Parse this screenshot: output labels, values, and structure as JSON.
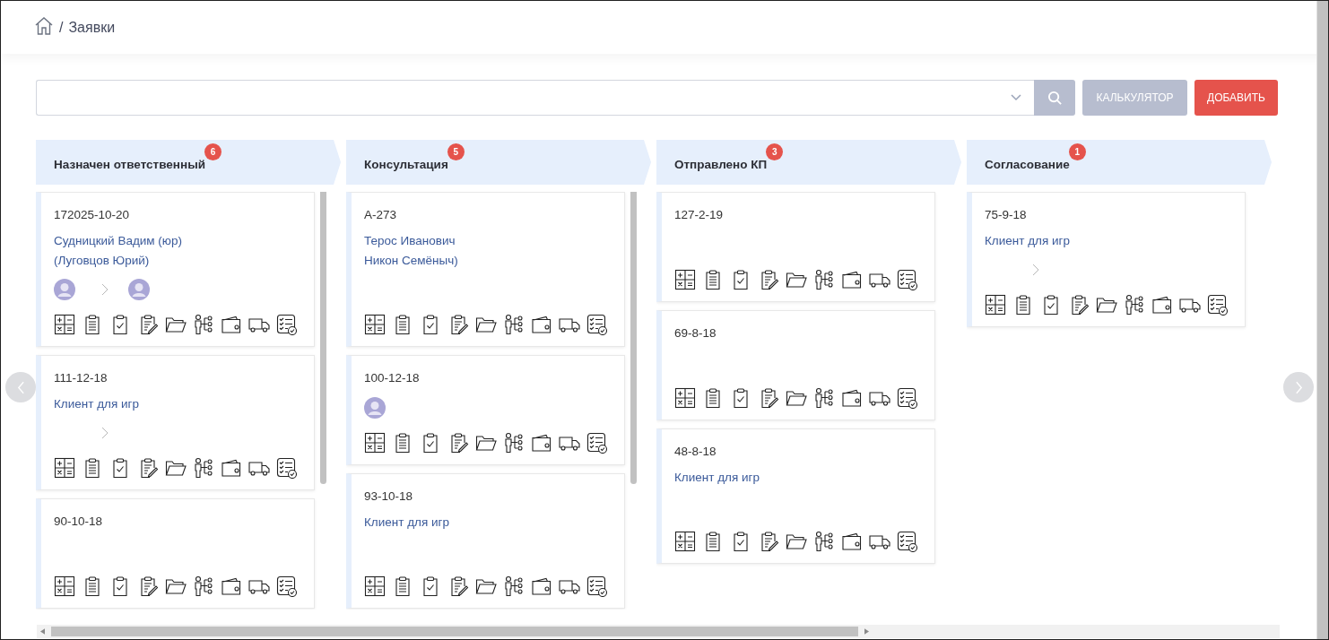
{
  "breadcrumb": {
    "separator": "/",
    "current": "Заявки"
  },
  "toolbar": {
    "calculator_button": "КАЛЬКУЛЯТОР",
    "add_button": "ДОБАВИТЬ"
  },
  "columns": [
    {
      "title": "Назначен ответственный",
      "count": "6",
      "scrollable": true,
      "cards": [
        {
          "number": "172025-10-20",
          "client_lines": [
            "Судницкий Вадим (юр)",
            "(Луговцов Юрий)"
          ],
          "people": [
            {
              "kind": "avatar"
            },
            {
              "kind": "arrow"
            },
            {
              "kind": "avatar"
            }
          ]
        },
        {
          "number": "111-12-18",
          "client_lines": [
            "Клиент для игр"
          ],
          "people": [
            {
              "kind": "gap"
            },
            {
              "kind": "arrow"
            }
          ]
        },
        {
          "number": "90-10-18"
        }
      ]
    },
    {
      "title": "Консультация",
      "count": "5",
      "scrollable": true,
      "cards": [
        {
          "number": "А-273",
          "client_lines": [
            "Терос Иванович",
            "Никон Семёныч)"
          ]
        },
        {
          "number": "100-12-18",
          "people": [
            {
              "kind": "avatar"
            }
          ]
        },
        {
          "number": "93-10-18",
          "client_lines": [
            "Клиент для игр"
          ]
        }
      ]
    },
    {
      "title": "Отправлено КП",
      "count": "3",
      "cards": [
        {
          "number": "127-2-19"
        },
        {
          "number": "69-8-18"
        },
        {
          "number": "48-8-18",
          "client_lines": [
            "Клиент для игр"
          ]
        }
      ]
    },
    {
      "title": "Согласование",
      "count": "1",
      "cards": [
        {
          "number": "75-9-18",
          "client_lines": [
            "Клиент для игр"
          ],
          "people": [
            {
              "kind": "gap"
            },
            {
              "kind": "arrow"
            }
          ]
        }
      ]
    }
  ]
}
